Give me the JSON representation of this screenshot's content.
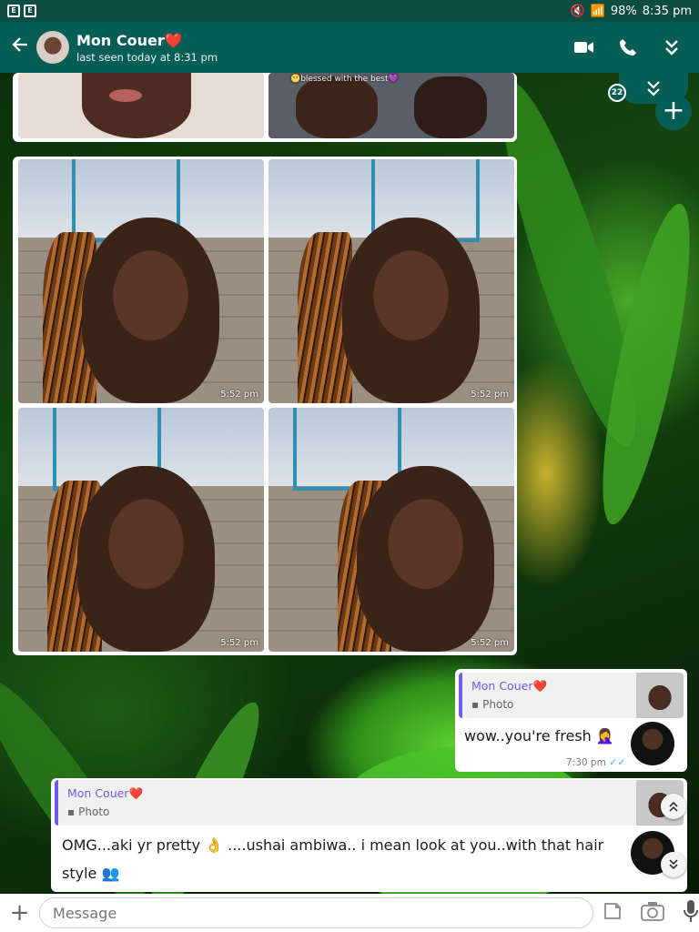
{
  "status_bar": {
    "battery": "98%",
    "time": "8:35 pm"
  },
  "header": {
    "contact_name": "Mon Couer❤️",
    "last_seen": "last seen today at 8:31 pm"
  },
  "top_album": {
    "caption": "😬blessed with the best💜"
  },
  "photo_album": {
    "times": [
      "5:52 pm",
      "5:52 pm",
      "5:52 pm",
      "5:52 pm"
    ]
  },
  "messages": [
    {
      "quote_name": "Mon Couer❤️",
      "quote_type": "Photo",
      "text": "wow..you're fresh 🤦‍♀️",
      "time": "7:30 pm"
    },
    {
      "quote_name": "Mon Couer❤️",
      "quote_type": "Photo",
      "text_line1": "OMG...aki yr pretty 👌 ....ushai ambiwa.. i mean look at you..with that  hair",
      "text_line2": "style 👥"
    }
  ],
  "unread_count": "22",
  "input": {
    "placeholder": "Message"
  },
  "colors": {
    "header": "#075e54",
    "status_bar": "#0b4d43",
    "quote_accent": "#6c5ce7",
    "read_ticks": "#34b7f1"
  },
  "icons": {
    "back": "arrow-left-icon",
    "video": "video-camera-icon",
    "call": "phone-icon",
    "collapse": "double-chevron-down-icon",
    "add": "plus-icon",
    "sticker": "sticker-icon",
    "camera": "camera-icon",
    "mic": "microphone-icon"
  }
}
